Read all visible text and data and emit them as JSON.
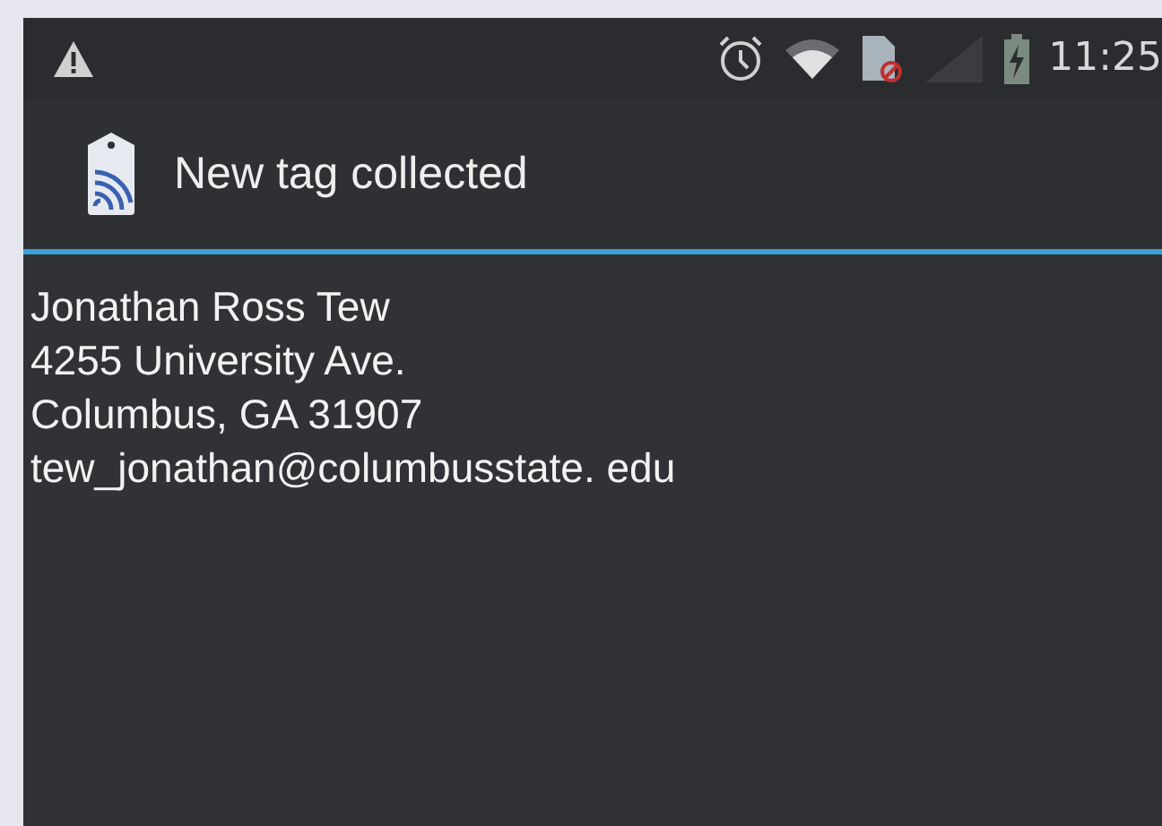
{
  "status_bar": {
    "time": "11:25"
  },
  "title_bar": {
    "title": "New tag collected"
  },
  "tag_content": [
    "Jonathan Ross Tew",
    "4255 University Ave.",
    "Columbus, GA 31907",
    "tew_jonathan@columbusstate. edu"
  ]
}
